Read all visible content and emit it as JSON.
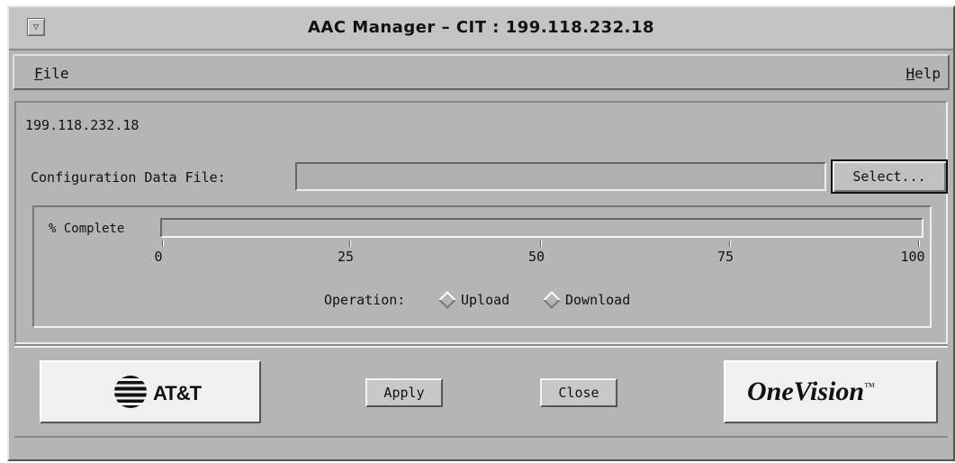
{
  "window": {
    "title": "AAC Manager – CIT : 199.118.232.18",
    "menu_icon": "window-menu-icon"
  },
  "menubar": {
    "file_mnemonic": "F",
    "file_rest": "ile",
    "help_mnemonic": "H",
    "help_rest": "elp"
  },
  "main": {
    "host": "199.118.232.18",
    "config_label": "Configuration Data File:",
    "config_value": "",
    "select_label": "Select..."
  },
  "progress": {
    "label": "% Complete",
    "value": 0.0,
    "ticks": [
      "0",
      "25",
      "50",
      "75",
      "100"
    ]
  },
  "operation": {
    "label": "Operation:",
    "options": [
      "Upload",
      "Download"
    ]
  },
  "buttons": {
    "apply": "Apply",
    "close": "Close"
  },
  "logos": {
    "att": "AT&T",
    "onevision": "OneVision",
    "onevision_tm": "™"
  },
  "colors": {
    "window_bg": "#b5b5b5",
    "progress_fill": "#888888"
  }
}
